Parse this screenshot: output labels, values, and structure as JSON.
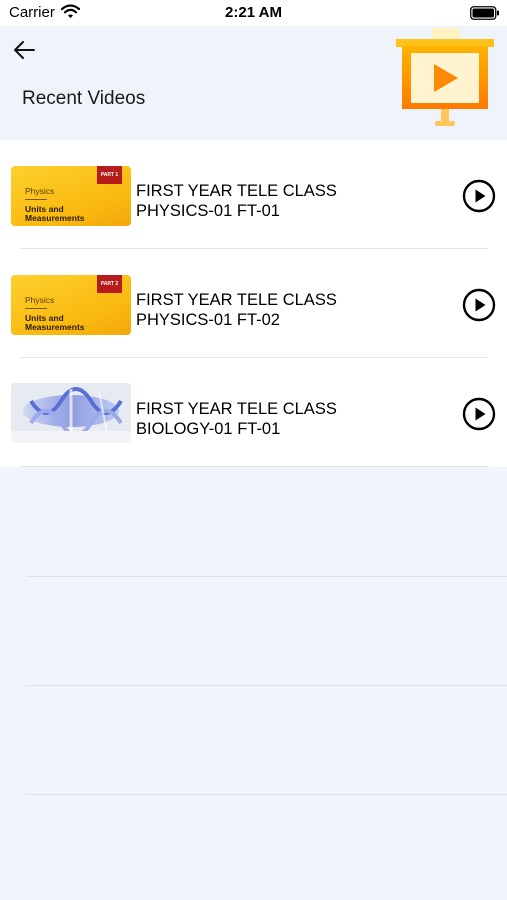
{
  "status_bar": {
    "carrier": "Carrier",
    "time": "2:21 AM"
  },
  "header": {
    "title": "Recent Videos",
    "back_icon": "arrow-left-icon",
    "illustration_icon": "presentation-board-play-icon"
  },
  "videos": [
    {
      "title_line1": "FIRST YEAR TELE CLASS",
      "title_line2": "PHYSICS-01 FT-01",
      "thumb_subject": "Physics",
      "thumb_topic_line1": "Units and",
      "thumb_topic_line2": "Measurements",
      "thumb_badge": "PART 1"
    },
    {
      "title_line1": "FIRST YEAR TELE CLASS",
      "title_line2": "PHYSICS-01 FT-02",
      "thumb_subject": "Physics",
      "thumb_topic_line1": "Units and",
      "thumb_topic_line2": "Measurements",
      "thumb_badge": "PART 2"
    },
    {
      "title_line1": "FIRST YEAR TELE CLASS",
      "title_line2": "BIOLOGY-01 FT-01"
    }
  ],
  "colors": {
    "background": "#eff5fb",
    "list_background": "#ffffff",
    "thumb_yellow": "#fbc21a",
    "badge_red": "#b71c1c",
    "icon_orange": "#f57c00"
  }
}
